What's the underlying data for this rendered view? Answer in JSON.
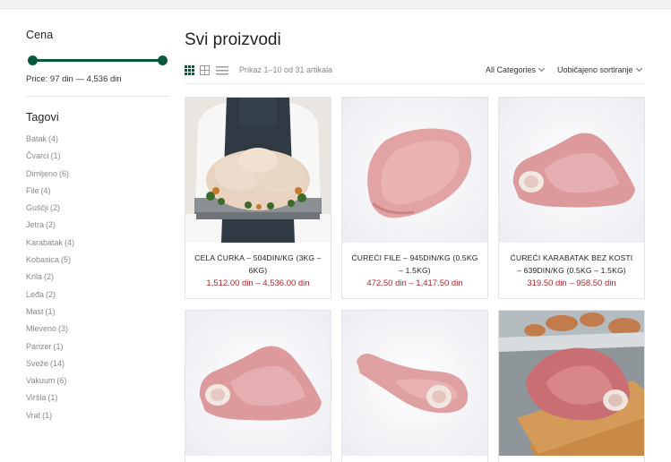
{
  "sidebar": {
    "price_title": "Cena",
    "price_text": "Price: 97 din — 4,536 din",
    "tags_title": "Tagovi",
    "tags": [
      {
        "name": "Batak",
        "count": "(4)"
      },
      {
        "name": "Čvarci",
        "count": "(1)"
      },
      {
        "name": "Dimljeno",
        "count": "(6)"
      },
      {
        "name": "File",
        "count": "(4)"
      },
      {
        "name": "Guščji",
        "count": "(2)"
      },
      {
        "name": "Jetra",
        "count": "(2)"
      },
      {
        "name": "Karabatak",
        "count": "(4)"
      },
      {
        "name": "Kobasica",
        "count": "(5)"
      },
      {
        "name": "Krila",
        "count": "(2)"
      },
      {
        "name": "Leđa",
        "count": "(2)"
      },
      {
        "name": "Mast",
        "count": "(1)"
      },
      {
        "name": "Mleveno",
        "count": "(3)"
      },
      {
        "name": "Parizer",
        "count": "(1)"
      },
      {
        "name": "Sveže",
        "count": "(14)"
      },
      {
        "name": "Vakuum",
        "count": "(6)"
      },
      {
        "name": "Viršla",
        "count": "(1)"
      },
      {
        "name": "Vrat",
        "count": "(1)"
      }
    ]
  },
  "main": {
    "title": "Svi proizvodi",
    "results_text": "Prikaz 1–10 od 31 artikala",
    "category_label": "All Categories",
    "sort_label": "Uobičajeno sortiranje"
  },
  "products": [
    {
      "name": "CELA ĆURKA – 504DIN/KG (3KG – 6KG)",
      "price": "1,512.00 din – 4,536.00 din"
    },
    {
      "name": "ĆUREĆI FILE – 945DIN/KG (0.5KG – 1.5KG)",
      "price": "472.50 din – 1,417.50 din"
    },
    {
      "name": "ĆUREĆI KARABATAK BEZ KOSTI – 639DIN/KG (0.5KG – 1.5KG)",
      "price": "319.50 din – 958.50 din"
    },
    {
      "name": "",
      "price": ""
    },
    {
      "name": "",
      "price": ""
    },
    {
      "name": "",
      "price": ""
    }
  ],
  "colors": {
    "accent": "#0a5a3a",
    "price": "#b0252a"
  }
}
